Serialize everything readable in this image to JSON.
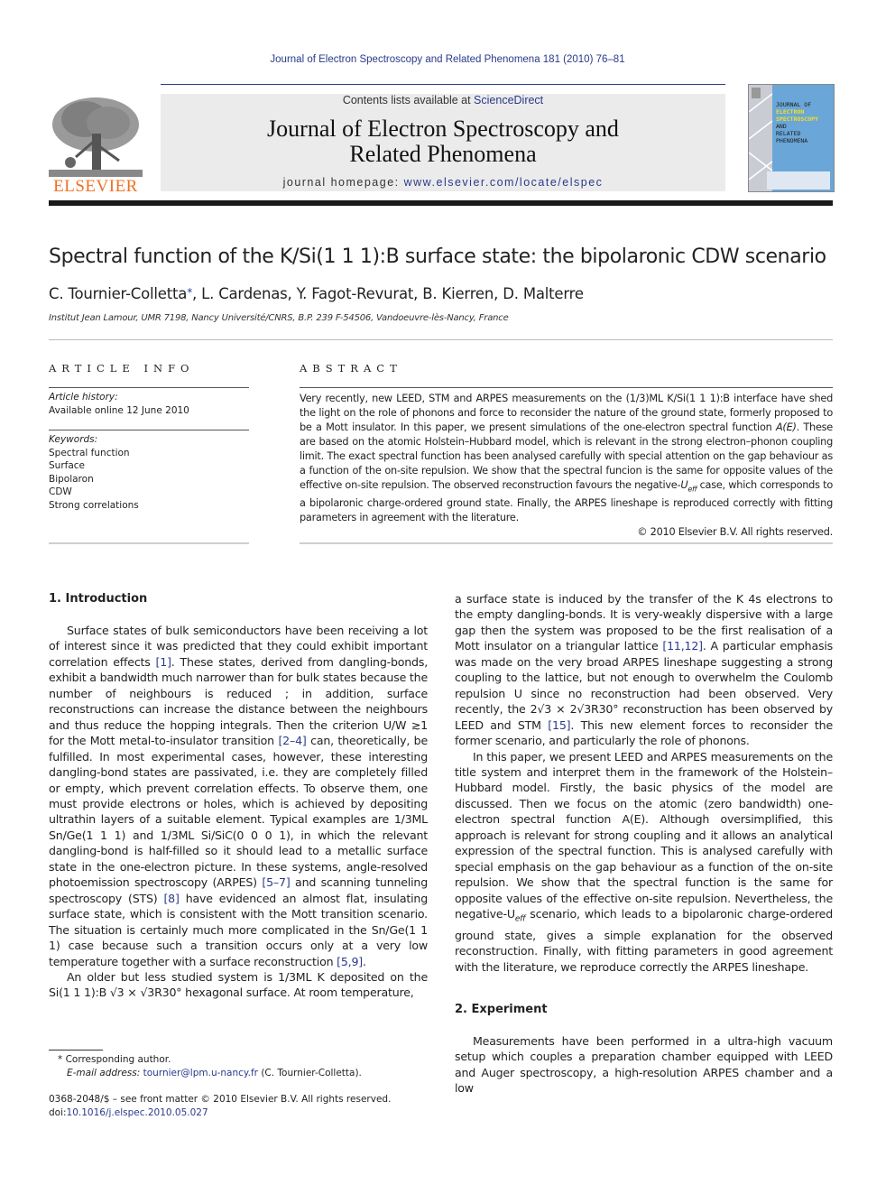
{
  "running_head": "Journal of Electron Spectroscopy and Related Phenomena 181 (2010) 76–81",
  "masthead": {
    "publisher": "ELSEVIER",
    "contents_prefix": "Contents lists available at ",
    "contents_link": "ScienceDirect",
    "journal_title_line1": "Journal of Electron Spectroscopy and",
    "journal_title_line2": "Related Phenomena",
    "homepage_prefix": "journal homepage: ",
    "homepage_link": "www.elsevier.com/locate/elspec",
    "cover": {
      "line1": "JOURNAL OF",
      "line2": "ELECTRON",
      "line3": "SPECTROSCOPY",
      "line4": "AND",
      "line5": "RELATED PHENOMENA",
      "bg_color": "#6aa6d8",
      "accent_color": "#f2e020"
    }
  },
  "article": {
    "title": "Spectral function of the K/Si(1 1 1):B surface state: the bipolaronic CDW scenario",
    "authors": "C. Tournier-Colletta",
    "author_mark": "*",
    "authors_rest": ", L. Cardenas, Y. Fagot-Revurat, B. Kierren, D. Malterre",
    "affiliation": "Institut Jean Lamour, UMR 7198, Nancy Université/CNRS, B.P. 239 F-54506, Vandoeuvre-lès-Nancy, France"
  },
  "article_info": {
    "heading": "ARTICLE INFO",
    "history_label": "Article history:",
    "history_value": "Available online 12 June 2010",
    "keywords_label": "Keywords:",
    "keywords": [
      "Spectral function",
      "Surface",
      "Bipolaron",
      "CDW",
      "Strong correlations"
    ]
  },
  "abstract": {
    "heading": "ABSTRACT",
    "text_a": "Very recently, new LEED, STM and ARPES measurements on the (1/3)ML K/Si(1 1 1):B interface have shed the light on the role of phonons and force to reconsider the nature of the ground state, formerly proposed to be a Mott insulator. In this paper, we present simulations of the one-electron spectral function ",
    "text_AE": "A(E)",
    "text_b": ". These are based on the atomic Holstein–Hubbard model, which is relevant in the strong electron–phonon coupling limit. The exact spectral function has been analysed carefully with special attention on the gap behaviour as a function of the on-site repulsion. We show that the spectral funcion is the same for opposite values of the effective on-site repulsion. The observed reconstruction favours the negative-",
    "text_U": "U",
    "text_eff": "eff",
    "text_c": " case, which corresponds to a bipolaronic charge-ordered ground state. Finally, the ARPES lineshape is reproduced correctly with fitting parameters in agreement with the literature.",
    "copyright": "© 2010 Elsevier B.V. All rights reserved."
  },
  "sections": {
    "intro_heading": "1.  Introduction",
    "p1_a": "Surface states of bulk semiconductors have been receiving a lot of interest since it was predicted that they could exhibit important correlation effects ",
    "p1_ref1": "[1]",
    "p1_b": ". These states, derived from dangling-bonds, exhibit a bandwidth much narrower than for bulk states because the number of neighbours is reduced ; in addition, surface reconstructions can increase the distance between the neighbours and thus reduce the hopping integrals. Then the criterion U/W ≳1 for the Mott metal-to-insulator transition ",
    "p1_ref2": "[2–4]",
    "p1_c": " can, theoretically, be fulfilled. In most experimental cases, however, these interesting dangling-bond states are passivated, i.e. they are completely filled or empty, which prevent correlation effects. To observe them, one must provide electrons or holes, which is achieved by depositing ultrathin layers of a suitable element. Typical examples are 1/3ML Sn/Ge(1 1 1) and 1/3ML Si/SiC(0 0 0 1), in which the relevant dangling-bond is half-filled so it should lead to a metallic surface state in the one-electron picture. In these systems, angle-resolved photoemission spectroscopy (ARPES) ",
    "p1_ref3": "[5–7]",
    "p1_d": " and scanning tunneling spectroscopy (STS) ",
    "p1_ref4": "[8]",
    "p1_e": " have evidenced an almost flat, insulating surface state, which is consistent with the Mott transition scenario. The situation is certainly much more complicated in the Sn/Ge(1 1 1) case because such a transition occurs only at a very low temperature together with a surface reconstruction ",
    "p1_ref5": "[5,9]",
    "p1_f": ".",
    "p2": "An older but less studied system is 1/3ML K deposited on the Si(1 1 1):B √3 × √3R30° hexagonal surface. At room temperature,",
    "p3_a": "a surface state is induced by the transfer of the K 4s electrons to the empty dangling-bonds. It is very-weakly dispersive with a large gap then the system was proposed to be the first realisation of a Mott insulator on a triangular lattice ",
    "p3_ref1": "[11,12]",
    "p3_b": ". A particular emphasis was made on the very broad ARPES lineshape suggesting a strong coupling to the lattice, but not enough to overwhelm the Coulomb repulsion U since no reconstruction had been observed. Very recently, the 2√3 × 2√3R30° reconstruction has been observed by LEED and STM ",
    "p3_ref2": "[15]",
    "p3_c": ". This new element forces to reconsider the former scenario, and particularly the role of phonons.",
    "p4_a": "In this paper, we present LEED and ARPES measurements on the title system and interpret them in the framework of the Holstein–Hubbard model. Firstly, the basic physics of the model are discussed. Then we focus on the atomic (zero bandwidth) one-electron spectral function A(E). Although oversimplified, this approach is relevant for strong coupling and it allows an analytical expression of the spectral function. This is analysed carefully with special emphasis on the gap behaviour as a function of the on-site repulsion. We show that the spectral function is the same for opposite values of the effective on-site repulsion. Nevertheless, the negative-U",
    "p4_eff": "eff",
    "p4_b": " scenario, which leads to a bipolaronic charge-ordered ground state, gives a simple explanation for the observed reconstruction. Finally, with fitting parameters in good agreement with the literature, we reproduce correctly the ARPES lineshape.",
    "exp_heading": "2.  Experiment",
    "p5": "Measurements have been performed in a ultra-high vacuum setup which couples a preparation chamber equipped with LEED and Auger spectroscopy, a high-resolution ARPES chamber and a low"
  },
  "footnotes": {
    "corresponding": "* Corresponding author.",
    "email_label": "E-mail address: ",
    "email": "tournier@lpm.u-nancy.fr",
    "email_suffix": " (C. Tournier-Colletta).",
    "frontmatter": "0368-2048/$ – see front matter © 2010 Elsevier B.V. All rights reserved.",
    "doi_label": "doi:",
    "doi": "10.1016/j.elspec.2010.05.027"
  }
}
